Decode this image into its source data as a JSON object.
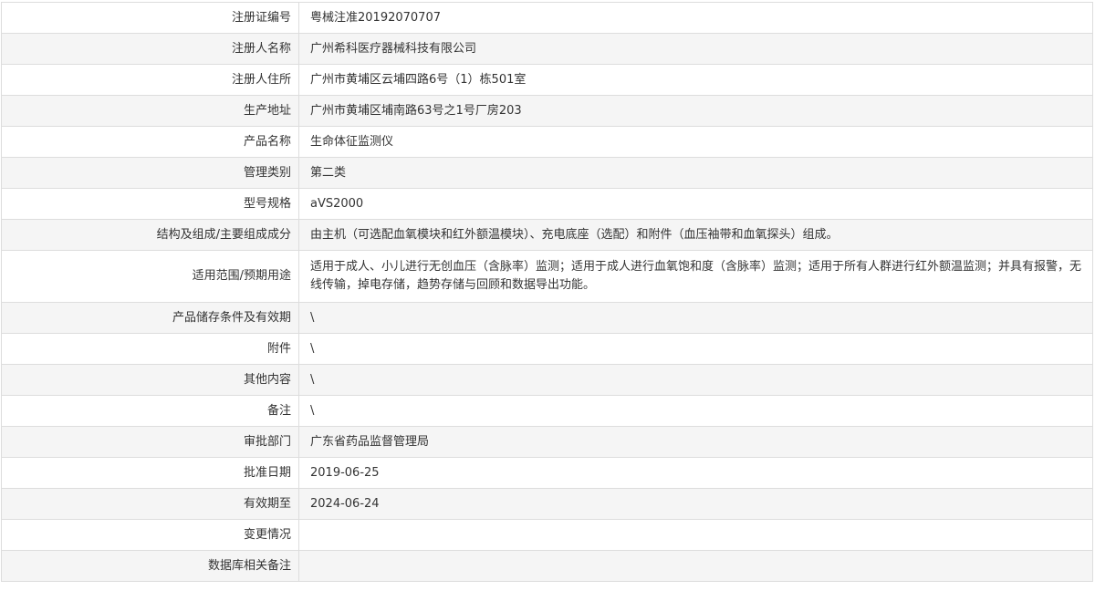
{
  "rows": [
    {
      "label": "注册证编号",
      "value": "粤械注准20192070707"
    },
    {
      "label": "注册人名称",
      "value": "广州希科医疗器械科技有限公司"
    },
    {
      "label": "注册人住所",
      "value": "广州市黄埔区云埔四路6号（1）栋501室"
    },
    {
      "label": "生产地址",
      "value": "广州市黄埔区埔南路63号之1号厂房203"
    },
    {
      "label": "产品名称",
      "value": "生命体征监测仪"
    },
    {
      "label": "管理类别",
      "value": "第二类"
    },
    {
      "label": "型号规格",
      "value": "aVS2000"
    },
    {
      "label": "结构及组成/主要组成成分",
      "value": "由主机（可选配血氧模块和红外额温模块）、充电底座（选配）和附件（血压袖带和血氧探头）组成。"
    },
    {
      "label": "适用范围/预期用途",
      "value": "适用于成人、小儿进行无创血压（含脉率）监测；适用于成人进行血氧饱和度（含脉率）监测；适用于所有人群进行红外额温监测；并具有报警，无线传输，掉电存储，趋势存储与回顾和数据导出功能。"
    },
    {
      "label": "产品储存条件及有效期",
      "value": "\\"
    },
    {
      "label": "附件",
      "value": "\\"
    },
    {
      "label": "其他内容",
      "value": "\\"
    },
    {
      "label": "备注",
      "value": "\\"
    },
    {
      "label": "审批部门",
      "value": "广东省药品监督管理局"
    },
    {
      "label": "批准日期",
      "value": "2019-06-25"
    },
    {
      "label": "有效期至",
      "value": "2024-06-24"
    },
    {
      "label": "变更情况",
      "value": ""
    },
    {
      "label": "数据库相关备注",
      "value": ""
    }
  ]
}
